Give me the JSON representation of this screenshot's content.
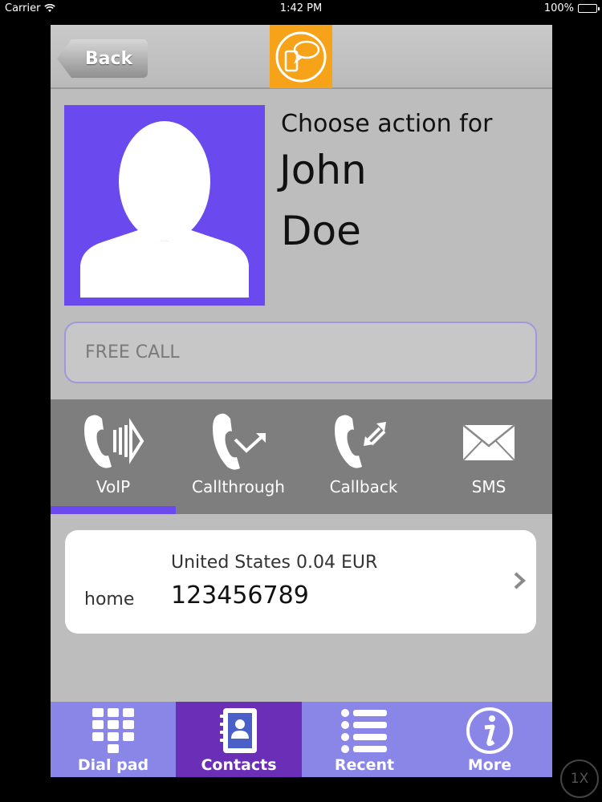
{
  "status_bar": {
    "carrier": "Carrier",
    "time": "1:42 PM",
    "battery": "100%"
  },
  "nav": {
    "back_label": "Back",
    "logo_icon": "chat-phone-logo-icon",
    "accent_color": "#f7a319"
  },
  "contact": {
    "choose_label": "Choose action for",
    "first_name": "John",
    "last_name": "Doe",
    "photo_color": "#6a49ee"
  },
  "free_call": {
    "placeholder": "FREE CALL",
    "value": ""
  },
  "actions": [
    {
      "label": "VoIP",
      "icon": "voip-icon",
      "selected": true
    },
    {
      "label": "Callthrough",
      "icon": "callthrough-icon",
      "selected": false
    },
    {
      "label": "Callback",
      "icon": "callback-icon",
      "selected": false
    },
    {
      "label": "SMS",
      "icon": "sms-envelope-icon",
      "selected": false
    }
  ],
  "number_card": {
    "rate": "United States 0.04 EUR",
    "type": "home",
    "phone": "123456789"
  },
  "tabs": [
    {
      "label": "Dial pad",
      "icon": "dial-pad-icon",
      "active": false
    },
    {
      "label": "Contacts",
      "icon": "contacts-book-icon",
      "active": true
    },
    {
      "label": "Recent",
      "icon": "recent-list-icon",
      "active": false
    },
    {
      "label": "More",
      "icon": "info-icon",
      "active": false
    }
  ],
  "zoom_badge": "1X"
}
